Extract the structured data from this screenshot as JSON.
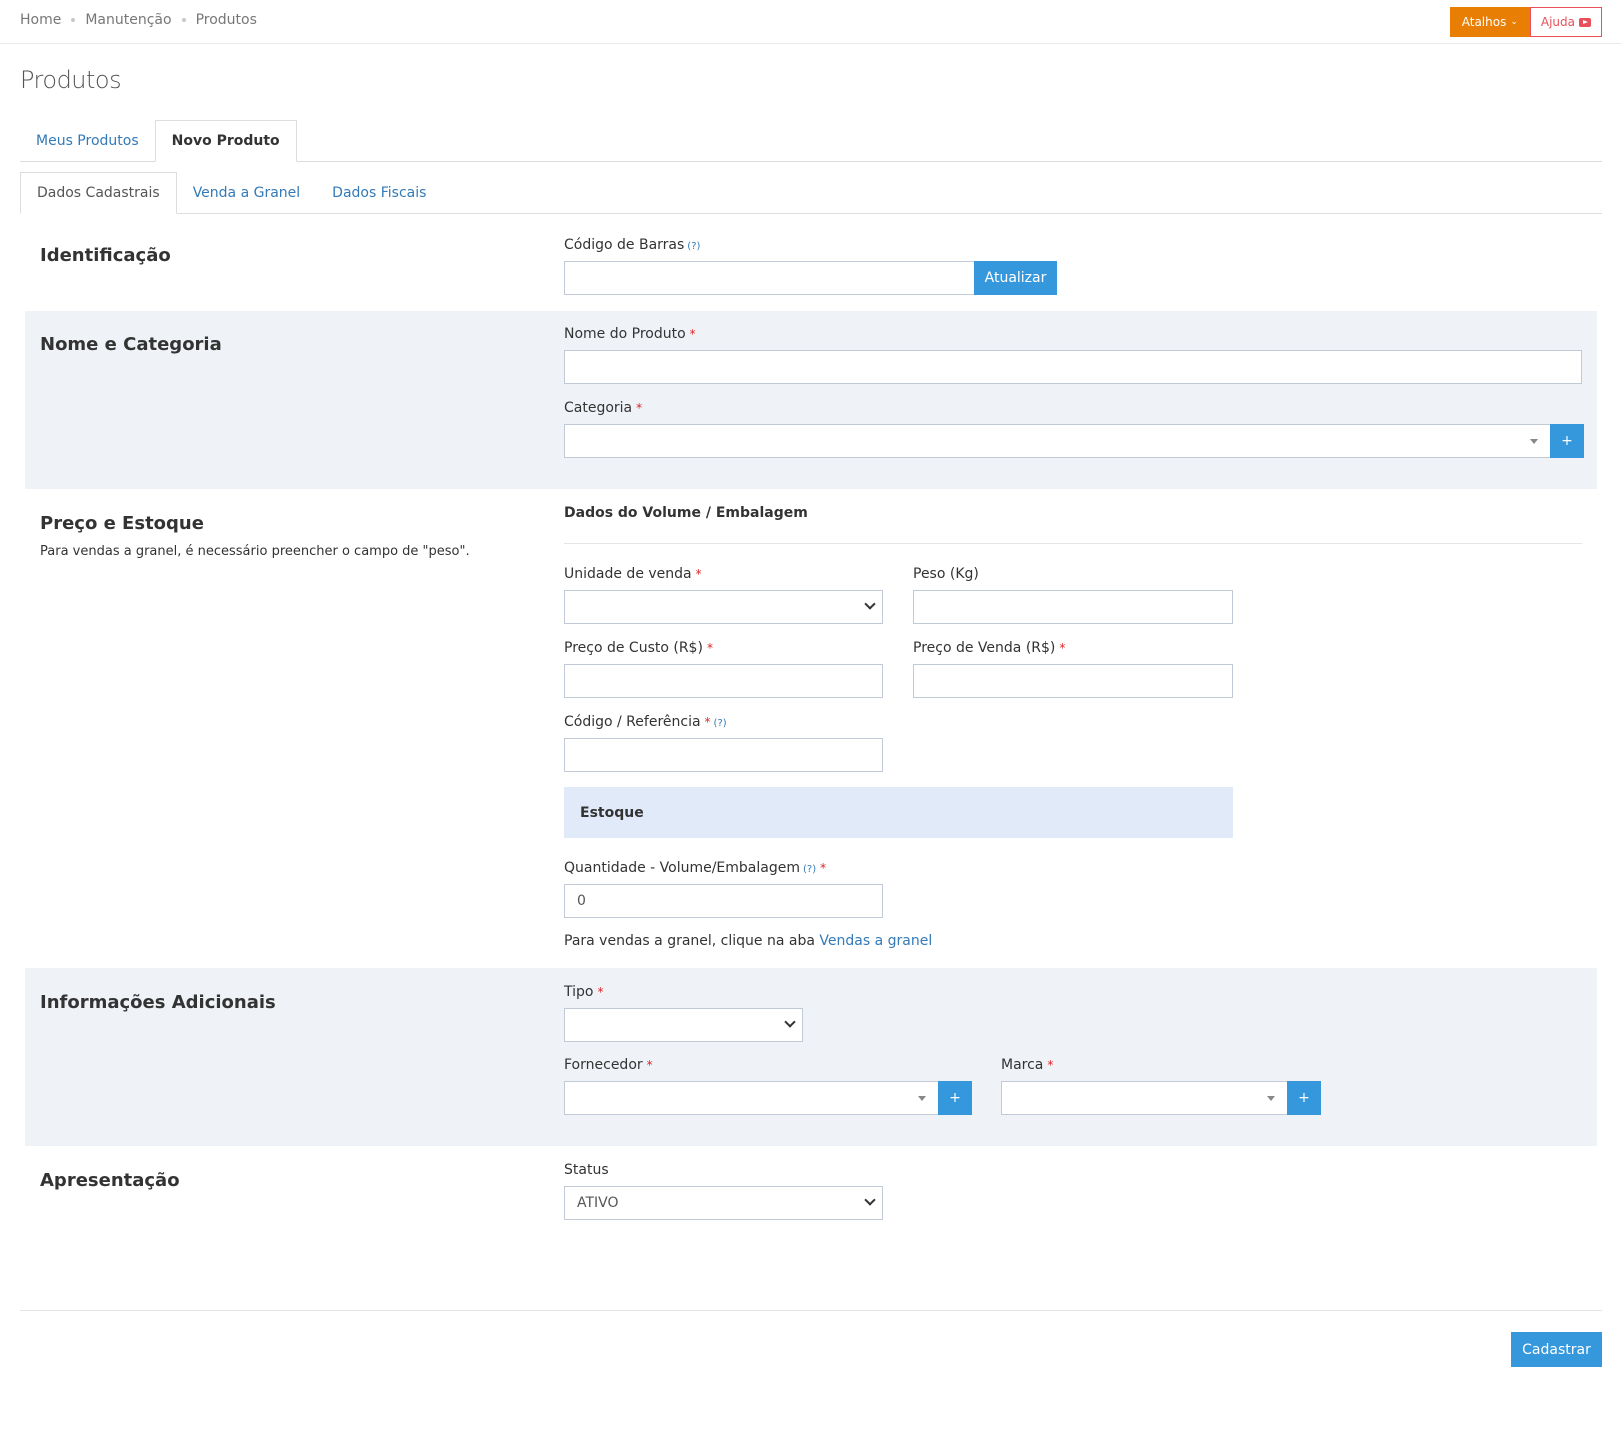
{
  "breadcrumb": [
    "Home",
    "Manutenção",
    "Produtos"
  ],
  "top_actions": {
    "atalhos": "Atalhos",
    "ajuda": "Ajuda"
  },
  "page_title": "Produtos",
  "main_tabs": [
    {
      "label": "Meus Produtos",
      "active": false
    },
    {
      "label": "Novo Produto",
      "active": true
    }
  ],
  "sub_tabs": [
    {
      "label": "Dados Cadastrais",
      "active": true
    },
    {
      "label": "Venda a Granel",
      "active": false
    },
    {
      "label": "Dados Fiscais",
      "active": false
    }
  ],
  "identificacao": {
    "title": "Identificação",
    "barcode_label": "Código de Barras",
    "help": "(?)",
    "barcode_value": "",
    "update_button": "Atualizar"
  },
  "nome_categoria": {
    "title": "Nome e Categoria",
    "nome_label": "Nome do Produto",
    "nome_value": "",
    "categoria_label": "Categoria",
    "categoria_value": "",
    "add_button": "+"
  },
  "preco_estoque": {
    "title": "Preço e Estoque",
    "description": "Para vendas a granel, é necessário preencher o campo de \"peso\".",
    "volume_heading": "Dados do Volume / Embalagem",
    "unidade_label": "Unidade de venda",
    "unidade_value": "",
    "peso_label": "Peso (Kg)",
    "peso_value": "",
    "custo_label": "Preço de Custo (R$)",
    "custo_value": "",
    "venda_label": "Preço de Venda (R$)",
    "venda_value": "",
    "codigo_label": "Código / Referência",
    "codigo_value": "",
    "help": "(?)",
    "estoque_heading": "Estoque",
    "quantidade_label": "Quantidade - Volume/Embalagem",
    "quantidade_value": "0",
    "granel_note": "Para vendas a granel, clique na aba",
    "granel_link": "Vendas a granel"
  },
  "info_adicionais": {
    "title": "Informações Adicionais",
    "tipo_label": "Tipo",
    "tipo_value": "",
    "fornecedor_label": "Fornecedor",
    "fornecedor_value": "",
    "marca_label": "Marca",
    "marca_value": "",
    "add_button": "+"
  },
  "apresentacao": {
    "title": "Apresentação",
    "status_label": "Status",
    "status_value": "ATIVO"
  },
  "footer": {
    "submit_button": "Cadastrar"
  },
  "required_mark": "*",
  "colors": {
    "accent_blue": "#3598dc",
    "orange": "#e87e04",
    "red": "#e7505a",
    "section_grey": "#eff3f8",
    "stock_blue": "#e0eaf8"
  }
}
